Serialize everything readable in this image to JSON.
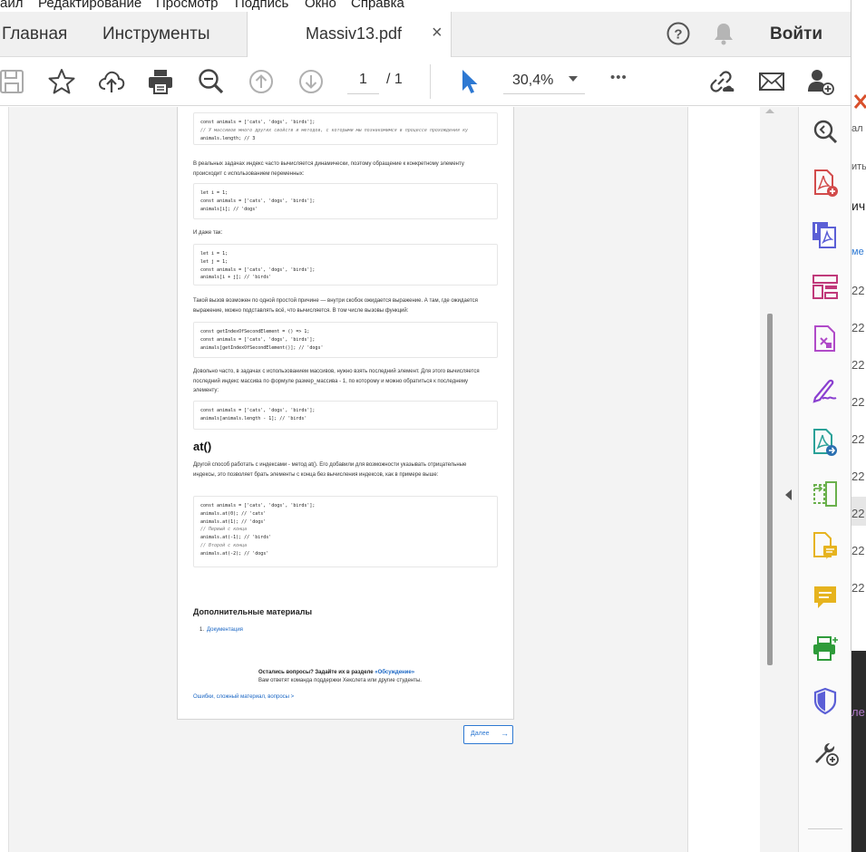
{
  "menu": [
    "айл",
    "Редактирование",
    "Просмотр",
    "Подпись",
    "Окно",
    "Справка"
  ],
  "tabs": {
    "home": "Главная",
    "tools": "Инструменты",
    "file": "Massiv13.pdf",
    "close": "×",
    "signin": "Войти"
  },
  "toolbar": {
    "page_current": "1",
    "page_total": "/ 1",
    "zoom": "30,4%",
    "more": "•••"
  },
  "doc": {
    "code1": [
      {
        "t": "const animals = ['cats', 'dogs', 'birds'];",
        "k": "code"
      },
      {
        "t": "// У массивов много других свойств и методов, с которыми мы познакомимся в процессе прохождения ку",
        "k": "comment"
      },
      {
        "t": "animals.length; // 3",
        "k": "code"
      }
    ],
    "p1": "В реальных задачах индекс часто вычисляется динамически, поэтому обращение к конкретному элементу происходит с использованием переменных:",
    "code2": [
      {
        "t": "let i = 1;",
        "k": "code"
      },
      {
        "t": "const animals = ['cats', 'dogs', 'birds'];",
        "k": "code"
      },
      {
        "t": "animals[i]; // 'dogs'",
        "k": "code"
      }
    ],
    "p2": "И даже так:",
    "code3": [
      {
        "t": "let i = 1;",
        "k": "code"
      },
      {
        "t": "let j = 1;",
        "k": "code"
      },
      {
        "t": "const animals = ['cats', 'dogs', 'birds'];",
        "k": "code"
      },
      {
        "t": "animals[i + j]; // 'birds'",
        "k": "code"
      }
    ],
    "p3": "Такой вызов возможен по одной простой причине — внутри скобок ожидается выражение. А там, где ожидается выражение, можно подставлять всё, что вычисляется. В том числе вызовы функций:",
    "code4": [
      {
        "t": "const getIndexOfSecondElement = () => 1;",
        "k": "code"
      },
      {
        "t": "const animals = ['cats', 'dogs', 'birds'];",
        "k": "code"
      },
      {
        "t": "animals[getIndexOfSecondElement()]; // 'dogs'",
        "k": "code"
      }
    ],
    "p4": "Довольно часто, в задачах с использованием массивов, нужно взять последний элемент. Для этого вычисляется последний индекс массива по формуле размер_массива - 1, по которому и можно обратиться к последнему элементу:",
    "code5": [
      {
        "t": "const animals = ['cats', 'dogs', 'birds'];",
        "k": "code"
      },
      {
        "t": "animals[animals.length - 1]; // 'birds'",
        "k": "code"
      }
    ],
    "h_at": "at()",
    "p5": "Другой способ работать с индексами - метод at(). Его добавили для возможности указывать отрицательные индексы, это позволяет брать элементы с конца без вычисления индексов, как в примере выше:",
    "code6": [
      {
        "t": "const animals = ['cats', 'dogs', 'birds'];",
        "k": "code"
      },
      {
        "t": "animals.at(0); // 'cats'",
        "k": "code"
      },
      {
        "t": "animals.at(1); // 'dogs'",
        "k": "code"
      },
      {
        "t": "// Первый с конца",
        "k": "comment"
      },
      {
        "t": "animals.at(-1); // 'birds'",
        "k": "code"
      },
      {
        "t": "// Второй с конца",
        "k": "comment"
      },
      {
        "t": "animals.at(-2); // 'dogs'",
        "k": "code"
      }
    ],
    "h_more": "Дополнительные материалы",
    "li1_num": "1.",
    "li1": "Документация",
    "q_bold": "Остались вопросы? Задайте их в разделе",
    "q_link": "«Обсуждение»",
    "q_sub": "Вам ответят команда поддержки Хекслета или другие студенты.",
    "errors_link": "Ошибки, сложный материал, вопросы >",
    "next": "Далее",
    "next_arrow": "→"
  },
  "behind_window": [
    "ал",
    "ить",
    "ич",
    "ме",
    "22",
    "22",
    "22",
    "22",
    "22",
    "22",
    "22",
    "22",
    "22",
    "ле"
  ],
  "icons": {
    "toolbar": [
      "save-icon",
      "star-icon",
      "cloud-upload-icon",
      "print-icon",
      "zoom-out-icon",
      "page-up-icon",
      "page-down-icon",
      "cursor-icon",
      "dropdown-icon",
      "more-icon",
      "link-icon",
      "mail-icon",
      "add-user-icon"
    ],
    "right_panel": [
      "search-zoom-icon",
      "create-pdf-icon",
      "export-pdf-icon",
      "organize-pages-icon",
      "edit-pdf-icon",
      "fill-sign-icon",
      "send-track-icon",
      "compare-icon",
      "comment-doc-icon",
      "comment-icon",
      "print-production-icon",
      "protect-icon",
      "more-tools-icon"
    ]
  },
  "colors": {
    "accent_blue": "#2d78d2",
    "link_blue": "#1a66c4",
    "red": "#d24b4b",
    "purple": "#8a3fd0",
    "green": "#2e9b3a",
    "yellow": "#e6b31e",
    "indigo": "#5b5fd6"
  }
}
